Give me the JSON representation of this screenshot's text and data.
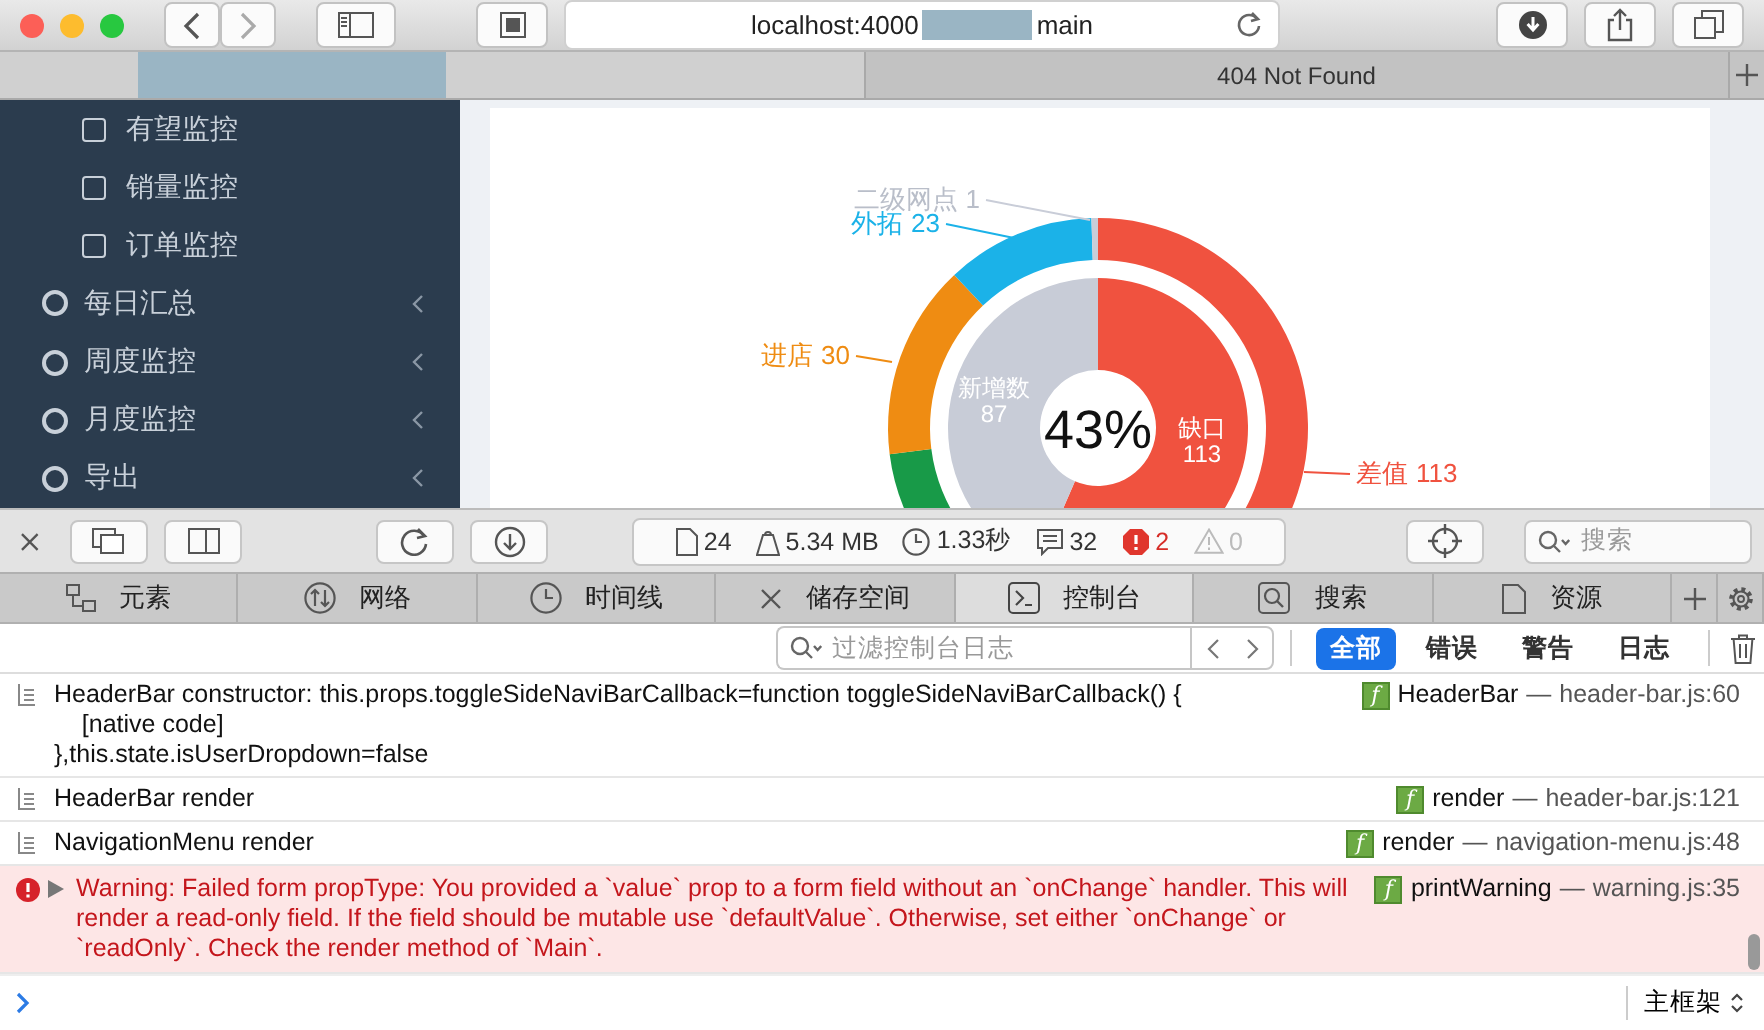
{
  "browser": {
    "url": {
      "prefix": "localhost:4000",
      "suffix": "main",
      "redacted": true
    },
    "tabs": [
      {
        "kind": "redacted",
        "selected": true
      },
      {
        "kind": "page",
        "title": "404 Not Found",
        "selected": false
      }
    ]
  },
  "sidebar": {
    "items": [
      {
        "kind": "sub",
        "label": "有望监控"
      },
      {
        "kind": "sub",
        "label": "销量监控"
      },
      {
        "kind": "sub",
        "label": "订单监控"
      },
      {
        "kind": "group",
        "label": "每日汇总"
      },
      {
        "kind": "group",
        "label": "周度监控"
      },
      {
        "kind": "group",
        "label": "月度监控"
      },
      {
        "kind": "group",
        "label": "导出"
      }
    ]
  },
  "chart": {
    "outer_ring": {
      "chart_data": {
        "type": "donut",
        "categories": [
          "差值",
          null,
          "进店",
          "外拓",
          "二级网点"
        ],
        "values": [
          113,
          33,
          30,
          23,
          1
        ],
        "value_labels": [
          "113",
          null,
          "30",
          "23",
          "1"
        ]
      }
    },
    "inner_ring": {
      "chart_data": {
        "type": "donut",
        "categories": [
          "缺口",
          "新增数"
        ],
        "values": [
          113,
          87
        ],
        "data_labels": true
      }
    },
    "center_label": "43%"
  },
  "devtools": {
    "stats": [
      {
        "kind": "resources",
        "text": "24"
      },
      {
        "kind": "size",
        "text": "5.34 MB"
      },
      {
        "kind": "time",
        "text": "1.33秒"
      },
      {
        "kind": "logs",
        "text": "32"
      },
      {
        "kind": "errors",
        "text": "2"
      },
      {
        "kind": "warnings",
        "text": "0"
      }
    ],
    "search": {
      "placeholder": "搜索"
    },
    "tabs": [
      {
        "kind": "elements",
        "label": "元素",
        "selected": false
      },
      {
        "kind": "network",
        "label": "网络",
        "selected": false
      },
      {
        "kind": "timeline",
        "label": "时间线",
        "selected": false
      },
      {
        "kind": "storage",
        "label": "储存空间",
        "selected": false
      },
      {
        "kind": "console",
        "label": "控制台",
        "selected": true
      },
      {
        "kind": "search",
        "label": "搜索",
        "selected": false
      },
      {
        "kind": "resources",
        "label": "资源",
        "selected": false
      }
    ],
    "filter": {
      "placeholder": "过滤控制台日志"
    },
    "levels": [
      {
        "label": "全部",
        "selected": true
      },
      {
        "label": "错误",
        "selected": false
      },
      {
        "label": "警告",
        "selected": false
      },
      {
        "label": "日志",
        "selected": false
      }
    ],
    "messages": [
      {
        "kind": "log",
        "text": "HeaderBar constructor: this.props.toggleSideNaviBarCallback=function toggleSideNaviBarCallback() {\n    [native code]\n},this.state.isUserDropdown=false",
        "badge": "f",
        "function": "HeaderBar",
        "separator": "—",
        "file": "header-bar.js:60"
      },
      {
        "kind": "log",
        "text": "HeaderBar render",
        "badge": "f",
        "function": "render",
        "separator": "—",
        "file": "header-bar.js:121"
      },
      {
        "kind": "log",
        "text": "NavigationMenu render",
        "badge": "f",
        "function": "render",
        "separator": "—",
        "file": "navigation-menu.js:48"
      },
      {
        "kind": "error",
        "text": "Warning: Failed form propType: You provided a `value` prop to a form field without an `onChange` handler. This will render a read-only field. If the field should be mutable use `defaultValue`. Otherwise, set either `onChange` or `readOnly`. Check the render method of `Main`.",
        "badge": "f",
        "function": "printWarning",
        "separator": "—",
        "file": "warning.js:35"
      }
    ],
    "frame_selector": "主框架"
  }
}
